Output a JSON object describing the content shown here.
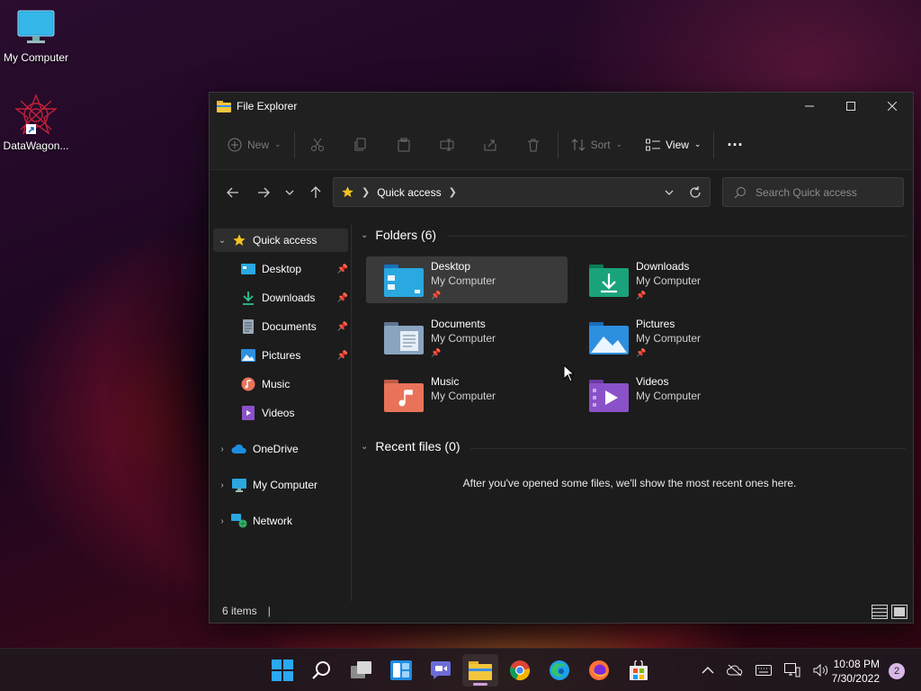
{
  "desktop": {
    "icons": [
      {
        "label": "My Computer",
        "icon": "monitor-icon"
      },
      {
        "label": "DataWagon...",
        "icon": "datawagon-shortcut-icon"
      }
    ]
  },
  "window": {
    "title": "File Explorer",
    "controls": [
      "minimize",
      "maximize",
      "close"
    ]
  },
  "toolbar": {
    "new_label": "New",
    "sort_label": "Sort",
    "view_label": "View",
    "more_label": "..."
  },
  "navigation": {
    "address_root_icon": "star-icon",
    "address_location": "Quick access",
    "search_placeholder": "Search Quick access"
  },
  "sidebar": {
    "items": [
      {
        "label": "Quick access",
        "icon": "star-icon",
        "expanded": true,
        "selected": true
      },
      {
        "label": "Desktop",
        "icon": "desktop-folder-icon",
        "pinned": true
      },
      {
        "label": "Downloads",
        "icon": "download-icon",
        "pinned": true
      },
      {
        "label": "Documents",
        "icon": "document-icon",
        "pinned": true
      },
      {
        "label": "Pictures",
        "icon": "pictures-icon",
        "pinned": true
      },
      {
        "label": "Music",
        "icon": "music-icon",
        "pinned": false
      },
      {
        "label": "Videos",
        "icon": "videos-icon",
        "pinned": false
      },
      {
        "label": "OneDrive",
        "icon": "cloud-icon",
        "expanded": false
      },
      {
        "label": "My Computer",
        "icon": "monitor-icon",
        "expanded": false
      },
      {
        "label": "Network",
        "icon": "network-icon",
        "expanded": false
      }
    ]
  },
  "main": {
    "folders_header": "Folders (6)",
    "folders": [
      {
        "name": "Desktop",
        "location": "My Computer",
        "pinned": true,
        "color": "#1e90d8"
      },
      {
        "name": "Downloads",
        "location": "My Computer",
        "pinned": true,
        "color": "#1aa37a"
      },
      {
        "name": "Documents",
        "location": "My Computer",
        "pinned": true,
        "color": "#8aa4c0"
      },
      {
        "name": "Pictures",
        "location": "My Computer",
        "pinned": true,
        "color": "#2d8fe0"
      },
      {
        "name": "Music",
        "location": "My Computer",
        "pinned": false,
        "color": "#e8735a"
      },
      {
        "name": "Videos",
        "location": "My Computer",
        "pinned": false,
        "color": "#8a52c8"
      }
    ],
    "recent_header": "Recent files (0)",
    "recent_empty_message": "After you've opened some files, we'll show the most recent ones here."
  },
  "statusbar": {
    "item_count": "6 items",
    "separator": "|"
  },
  "taskbar": {
    "apps": [
      "start-icon",
      "search-icon",
      "task-view-icon",
      "widgets-icon",
      "chat-icon",
      "file-explorer-icon",
      "chrome-icon",
      "edge-icon",
      "firefox-icon",
      "store-icon"
    ],
    "active_app": "file-explorer-icon",
    "time": "10:08 PM",
    "date": "7/30/2022",
    "notification_count": "2"
  },
  "colors": {
    "window_bg": "#1c1c1c",
    "accent_star": "#f4c320"
  }
}
